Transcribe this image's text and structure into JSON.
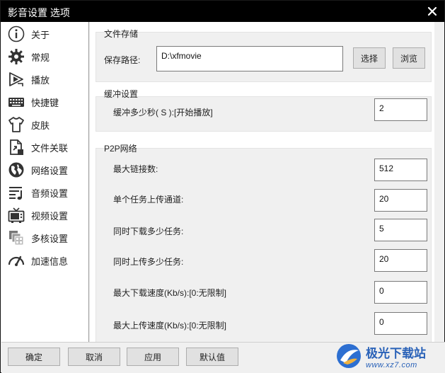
{
  "window": {
    "title": "影音设置 选项"
  },
  "sidebar": {
    "items": [
      {
        "label": "关于",
        "icon": "info-icon"
      },
      {
        "label": "常规",
        "icon": "gear-icon"
      },
      {
        "label": "播放",
        "icon": "play-icon"
      },
      {
        "label": "快捷键",
        "icon": "keyboard-icon"
      },
      {
        "label": "皮肤",
        "icon": "shirt-icon"
      },
      {
        "label": "文件关联",
        "icon": "file-link-icon"
      },
      {
        "label": "网络设置",
        "icon": "globe-icon"
      },
      {
        "label": "音频设置",
        "icon": "audio-list-icon"
      },
      {
        "label": "视频设置",
        "icon": "tv-icon"
      },
      {
        "label": "多核设置",
        "icon": "multicore-icon"
      },
      {
        "label": "加速信息",
        "icon": "speedometer-icon"
      }
    ]
  },
  "file_storage": {
    "title": "文件存储",
    "path_label": "保存路径:",
    "path_value": "D:\\xfmovie",
    "select_button": "选择",
    "browse_button": "浏览"
  },
  "buffer": {
    "title": "缓冲设置",
    "seconds_label": "缓冲多少秒( S ):[开始播放]",
    "seconds_value": "2"
  },
  "p2p": {
    "title": "P2P网络",
    "fields": [
      {
        "label": "最大链接数:",
        "value": "512"
      },
      {
        "label": "单个任务上传通道:",
        "value": "20"
      },
      {
        "label": "同时下载多少任务:",
        "value": "5"
      },
      {
        "label": "同时上传多少任务:",
        "value": "20"
      },
      {
        "label": "最大下载速度(Kb/s):[0:无限制]",
        "value": "0"
      },
      {
        "label": "最大上传速度(Kb/s):[0:无限制]",
        "value": "0"
      }
    ]
  },
  "footer": {
    "ok": "确定",
    "cancel": "取消",
    "apply": "应用",
    "default": "默认值"
  },
  "watermark": {
    "main": "极光下载站",
    "sub": "www.xz7.com"
  }
}
